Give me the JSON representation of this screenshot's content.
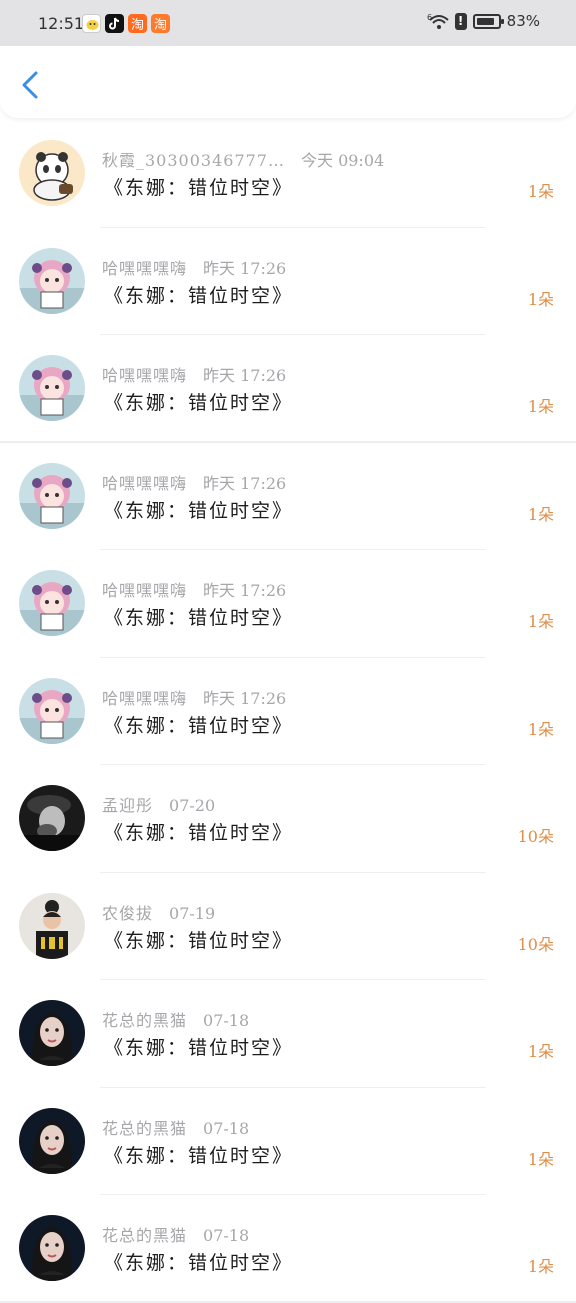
{
  "status_bar": {
    "time": "12:51",
    "battery": "83%",
    "battery_level": 0.83,
    "signal_label": "6",
    "app_icons": [
      "wechat-icon",
      "tiktok-icon",
      "taobao-icon",
      "taobao-alt-icon"
    ]
  },
  "header": {
    "back_icon": "chevron-left-icon",
    "accent_color": "#3a8ee6"
  },
  "records": [
    {
      "name": "秋霞_30300346777…",
      "time": "今天 09:04",
      "title": "《东娜：错位时空》",
      "count": "1朵",
      "avatar": "panda"
    },
    {
      "name": "哈嘿嘿嘿嗨",
      "time": "昨天 17:26",
      "title": "《东娜：错位时空》",
      "count": "1朵",
      "avatar": "pink-girl"
    },
    {
      "name": "哈嘿嘿嘿嗨",
      "time": "昨天 17:26",
      "title": "《东娜：错位时空》",
      "count": "1朵",
      "avatar": "pink-girl"
    },
    {
      "name": "哈嘿嘿嘿嗨",
      "time": "昨天 17:26",
      "title": "《东娜：错位时空》",
      "count": "1朵",
      "avatar": "pink-girl"
    },
    {
      "name": "哈嘿嘿嘿嗨",
      "time": "昨天 17:26",
      "title": "《东娜：错位时空》",
      "count": "1朵",
      "avatar": "pink-girl"
    },
    {
      "name": "哈嘿嘿嘿嗨",
      "time": "昨天 17:26",
      "title": "《东娜：错位时空》",
      "count": "1朵",
      "avatar": "pink-girl"
    },
    {
      "name": "孟迎彤",
      "time": "07-20",
      "title": "《东娜：错位时空》",
      "count": "10朵",
      "avatar": "dark-person"
    },
    {
      "name": "农俊拔",
      "time": "07-19",
      "title": "《东娜：错位时空》",
      "count": "10朵",
      "avatar": "child"
    },
    {
      "name": "花总的黑猫",
      "time": "07-18",
      "title": "《东娜：错位时空》",
      "count": "1朵",
      "avatar": "woman"
    },
    {
      "name": "花总的黑猫",
      "time": "07-18",
      "title": "《东娜：错位时空》",
      "count": "1朵",
      "avatar": "woman"
    },
    {
      "name": "花总的黑猫",
      "time": "07-18",
      "title": "《东娜：错位时空》",
      "count": "1朵",
      "avatar": "woman"
    }
  ],
  "colors": {
    "count": "#e08f4a",
    "meta": "#a7a7ab",
    "status_bar_bg": "#e3e3e6"
  }
}
